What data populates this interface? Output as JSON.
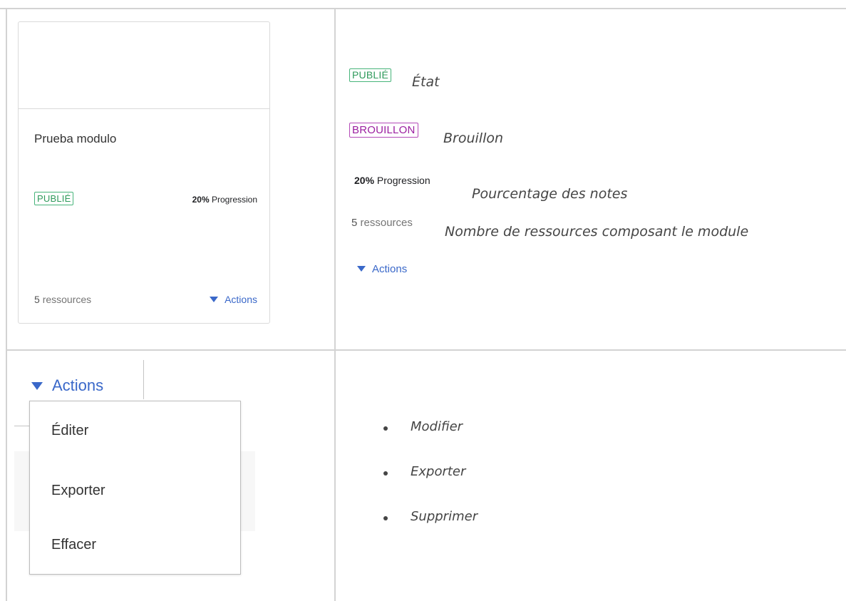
{
  "card": {
    "title": "Prueba modulo",
    "status_badge": "PUBLIÉ",
    "progress_value": "20%",
    "progress_label": "Progression",
    "resources_count": "5",
    "resources_label": "ressources",
    "actions_label": "Actions"
  },
  "legend": {
    "published_badge": "PUBLIÉ",
    "published_desc": "État",
    "draft_badge": "BROUILLON",
    "draft_desc": "Brouillon",
    "progress_value": "20%",
    "progress_label": "Progression",
    "progress_desc": "Pourcentage des notes",
    "resources_count": "5",
    "resources_label": "ressources",
    "resources_desc": "Nombre de ressources composant le module",
    "actions_label": "Actions"
  },
  "menu": {
    "trigger_label": "Actions",
    "items": [
      "Éditer",
      "Exporter",
      "Effacer"
    ]
  },
  "menu_legend": {
    "items": [
      "Modifier",
      "Exporter",
      "Supprimer"
    ]
  },
  "colors": {
    "published": "#2f9a5b",
    "draft": "#9b1fa0",
    "link": "#3a68c9"
  },
  "icons": {
    "dropdown": "caret-down-icon",
    "bullet": "bullet-icon"
  }
}
